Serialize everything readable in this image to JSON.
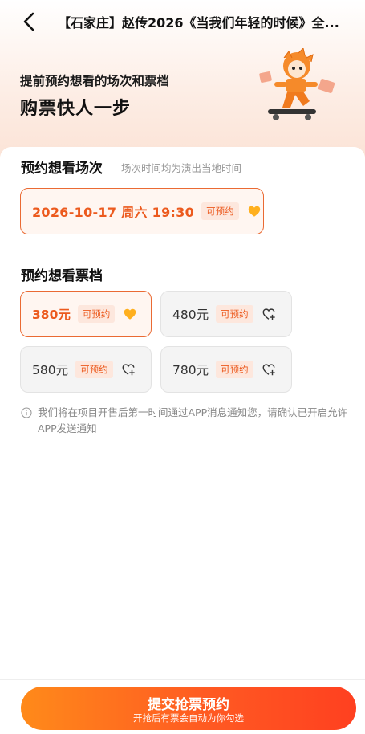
{
  "nav": {
    "title": "【石家庄】赵传2026《当我们年轻的时候》全...",
    "back_icon": "chevron-left-icon"
  },
  "hero": {
    "subtitle": "提前预约想看的场次和票档",
    "title": "购票快人一步",
    "mascot_icon": "skateboard-mascot-icon"
  },
  "session_section": {
    "title": "预约想看场次",
    "hint": "场次时间均为演出当地时间",
    "items": [
      {
        "label": "2026-10-17  周六 19:30",
        "tag": "可预约",
        "selected": true,
        "icon": "heart-filled-icon"
      }
    ]
  },
  "ticket_section": {
    "title": "预约想看票档",
    "items": [
      {
        "label": "380元",
        "tag": "可预约",
        "selected": true,
        "icon": "heart-filled-icon"
      },
      {
        "label": "480元",
        "tag": "可预约",
        "selected": false,
        "icon": "heart-add-icon"
      },
      {
        "label": "580元",
        "tag": "可预约",
        "selected": false,
        "icon": "heart-add-icon"
      },
      {
        "label": "780元",
        "tag": "可预约",
        "selected": false,
        "icon": "heart-add-icon"
      }
    ]
  },
  "notice": {
    "icon": "info-icon",
    "text": "我们将在项目开售后第一时间通过APP消息通知您，请确认已开启允许APP发送通知"
  },
  "submit": {
    "label": "提交抢票预约",
    "sublabel": "开抢后有票会自动为你勾选"
  },
  "colors": {
    "accent": "#ec5a1e",
    "heart": "#ffb01f",
    "button_start": "#ff8a1a",
    "button_end": "#ff4020"
  }
}
